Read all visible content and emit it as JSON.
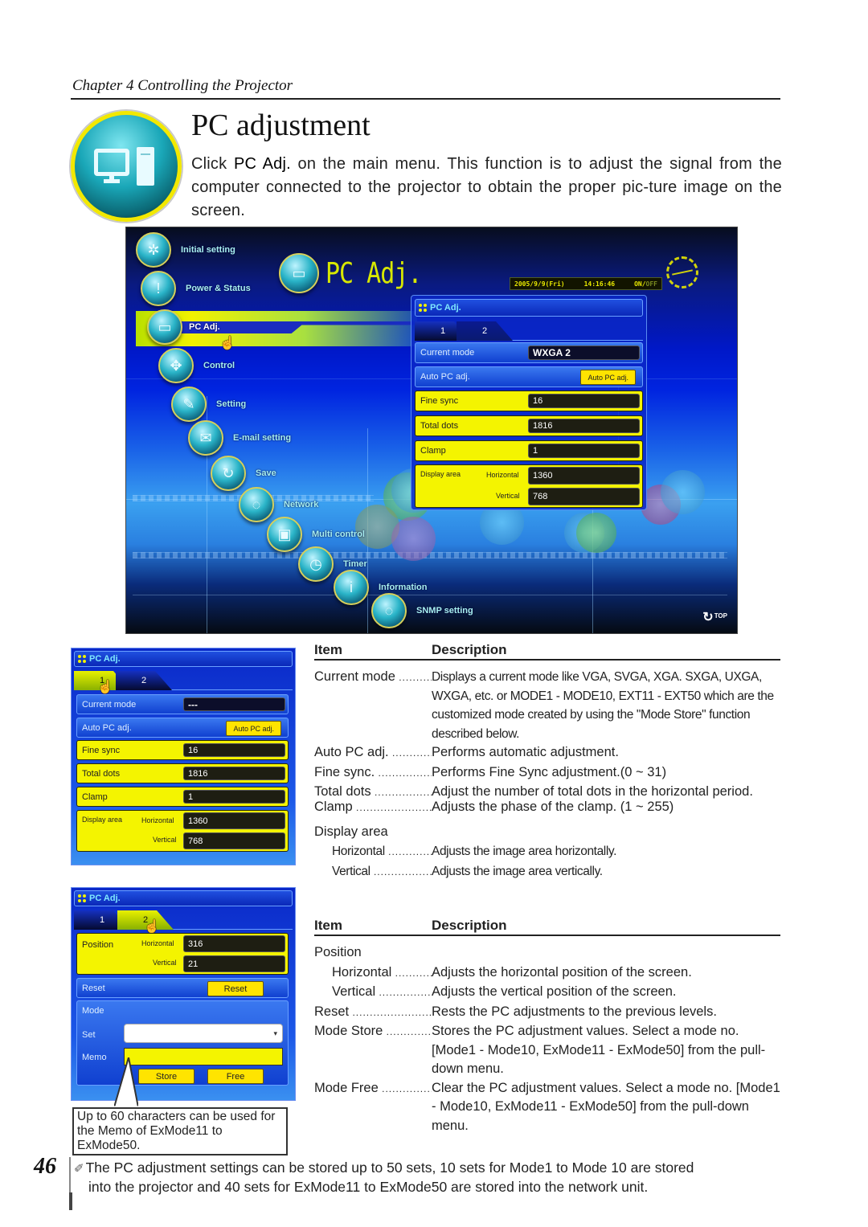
{
  "header": {
    "chapter": "Chapter 4 Controlling the Projector",
    "section_icon": "pc-adjust-icon",
    "title": "PC adjustment",
    "intro_prefix": "Click ",
    "intro_bold": "PC Adj.",
    "intro_suffix": " on the main menu. This function is to adjust the signal from the computer connected to the projector to obtain the proper pic-ture image on the screen."
  },
  "main_screen": {
    "logo_text": "PC Adj.",
    "clock": {
      "date": "2005/9/9(Fri)",
      "time": "14:16:46",
      "on": "ON/",
      "off": "OFF"
    },
    "nav": [
      {
        "label": "Initial setting",
        "icon": "gear-icon",
        "glyph": "✲"
      },
      {
        "label": "Power & Status",
        "icon": "projector-icon",
        "glyph": "!"
      },
      {
        "label": "PC Adj.",
        "icon": "pc-icon",
        "glyph": "▭",
        "active": true
      },
      {
        "label": "Control",
        "icon": "dpad-icon",
        "glyph": "✥"
      },
      {
        "label": "Setting",
        "icon": "wrench-icon",
        "glyph": "✎"
      },
      {
        "label": "E-mail setting",
        "icon": "mail-icon",
        "glyph": "✉"
      },
      {
        "label": "Save",
        "icon": "save-icon",
        "glyph": "↻"
      },
      {
        "label": "Network",
        "icon": "network-icon",
        "glyph": "◌"
      },
      {
        "label": "Multi control",
        "icon": "multi-control-icon",
        "glyph": "▣"
      },
      {
        "label": "Timer",
        "icon": "clock-icon",
        "glyph": "◷"
      },
      {
        "label": "Information",
        "icon": "info-icon",
        "glyph": "i"
      },
      {
        "label": "SNMP setting",
        "icon": "snmp-icon",
        "glyph": "◌"
      }
    ],
    "top_label": "TOP",
    "panel": {
      "title": "PC Adj.",
      "tabs": [
        "1",
        "2"
      ],
      "current_mode_label": "Current mode",
      "current_mode_value": "WXGA 2",
      "auto_label": "Auto PC adj.",
      "auto_button": "Auto PC adj.",
      "fine_sync_label": "Fine sync",
      "fine_sync_value": "16",
      "total_dots_label": "Total dots",
      "total_dots_value": "1816",
      "clamp_label": "Clamp",
      "clamp_value": "1",
      "display_area_label": "Display area",
      "horizontal_label": "Horizontal",
      "horizontal_value": "1360",
      "vertical_label": "Vertical",
      "vertical_value": "768"
    }
  },
  "panel_tab1": {
    "title": "PC Adj.",
    "tabs": [
      "1",
      "2"
    ],
    "current_mode_label": "Current mode",
    "current_mode_value": "---",
    "auto_label": "Auto PC adj.",
    "auto_button": "Auto PC adj.",
    "fine_sync_label": "Fine sync",
    "fine_sync_value": "16",
    "total_dots_label": "Total dots",
    "total_dots_value": "1816",
    "clamp_label": "Clamp",
    "clamp_value": "1",
    "display_area_label": "Display area",
    "horizontal_label": "Horizontal",
    "horizontal_value": "1360",
    "vertical_label": "Vertical",
    "vertical_value": "768"
  },
  "panel_tab2": {
    "title": "PC Adj.",
    "tabs": [
      "1",
      "2"
    ],
    "position_label": "Position",
    "horizontal_label": "Horizontal",
    "horizontal_value": "316",
    "vertical_label": "Vertical",
    "vertical_value": "21",
    "reset_label": "Reset",
    "reset_button": "Reset",
    "mode_label": "Mode",
    "set_label": "Set",
    "set_value": "",
    "memo_label": "Memo",
    "memo_value": "",
    "store_button": "Store",
    "free_button": "Free"
  },
  "callout": "Up to 60 characters can be used for the Memo of ExMode11 to ExMode50.",
  "table1": {
    "col_item": "Item",
    "col_desc": "Description",
    "rows": [
      {
        "term": "Current mode",
        "def": "Displays a current mode like VGA, SVGA, XGA. SXGA, UXGA, WXGA, etc. or MODE1 - MODE10, EXT11 - EXT50 which are the customized mode created by using the \"Mode Store\" function described below."
      },
      {
        "term": "Auto PC adj.",
        "def": "Performs automatic adjustment."
      },
      {
        "term": "Fine sync.",
        "def": "Performs Fine Sync adjustment.(0 ~ 31)"
      },
      {
        "term": "Total dots",
        "def": "Adjust the number of total dots in the horizontal period."
      },
      {
        "term": "Clamp",
        "def": "Adjusts the phase of the clamp. (1 ~ 255)"
      },
      {
        "term": "Display area",
        "def": ""
      },
      {
        "term": "Horizontal",
        "def": "Adjusts the image area horizontally."
      },
      {
        "term": "Vertical",
        "def": "Adjusts the image area vertically."
      }
    ]
  },
  "table2": {
    "col_item": "Item",
    "col_desc": "Description",
    "rows": [
      {
        "term": "Position",
        "def": ""
      },
      {
        "term": "Horizontal",
        "def": "Adjusts the horizontal position of the screen."
      },
      {
        "term": "Vertical",
        "def": "Adjusts the vertical position of the screen."
      },
      {
        "term": "Reset",
        "def": "Rests the PC adjustments to the previous levels."
      },
      {
        "term": "Mode Store",
        "def": "Stores the PC adjustment values. Select a mode no. [Mode1 - Mode10, ExMode11 - ExMode50] from the pull-down menu."
      },
      {
        "term": "Mode Free",
        "def": "Clear the PC adjustment values. Select a mode no.  [Mode1 - Mode10, ExMode11 - ExMode50] from the pull-down menu."
      }
    ]
  },
  "footer": {
    "page_number": "46",
    "note_icon": "pencil-note-icon",
    "note_line1": "The PC adjustment settings can be stored up to 50 sets, 10 sets for Mode1 to Mode 10 are stored",
    "note_line2": "into the projector and 40 sets for ExMode11 to ExMode50 are stored into the network unit."
  }
}
